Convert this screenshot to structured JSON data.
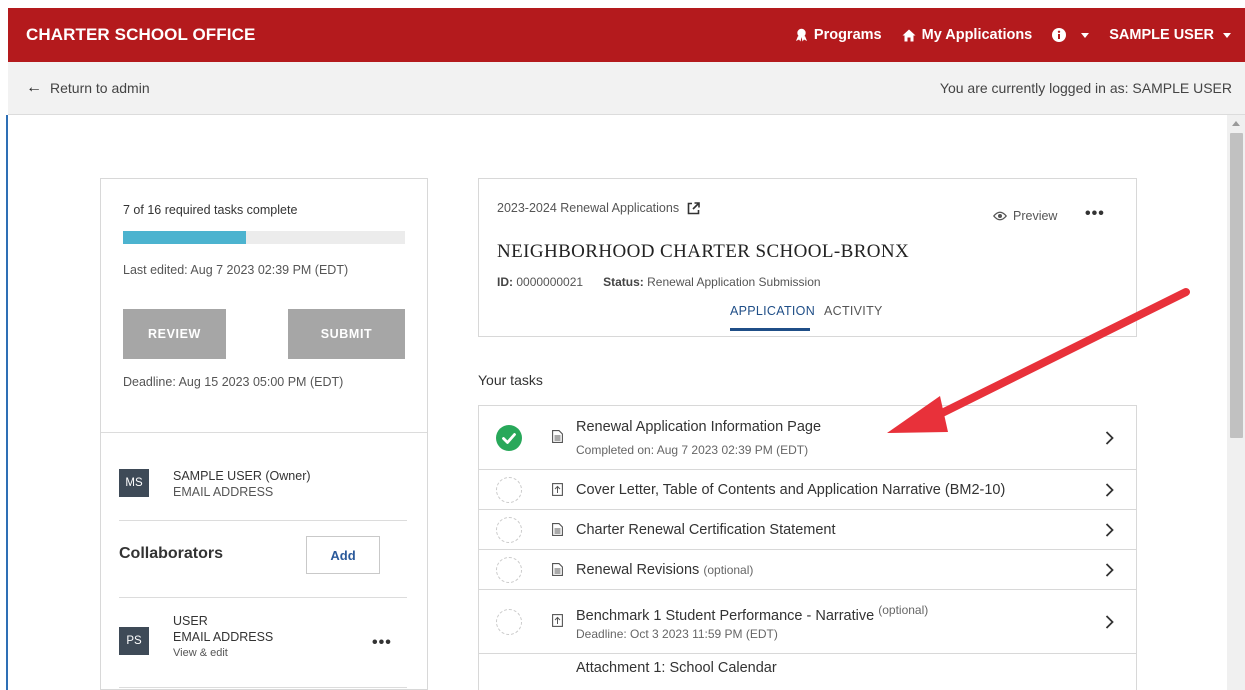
{
  "header": {
    "brand": "CHARTER SCHOOL OFFICE",
    "nav": {
      "programs": "Programs",
      "my_applications": "My Applications",
      "user": "SAMPLE USER"
    },
    "bg_color": "#b41a1d"
  },
  "subbar": {
    "return_label": "Return to admin",
    "logged_in": "You are currently logged in as: SAMPLE USER"
  },
  "summary": {
    "progress_text": "7 of 16 required tasks complete",
    "progress_fraction": 0.4375,
    "last_edited": "Last edited: Aug 7 2023 02:39 PM (EDT)",
    "review_label": "REVIEW",
    "submit_label": "SUBMIT",
    "deadline": "Deadline: Aug 15 2023 05:00 PM (EDT)"
  },
  "owner": {
    "initials": "MS",
    "name": "SAMPLE USER (Owner)",
    "email": "EMAIL ADDRESS"
  },
  "collaborators": {
    "title": "Collaborators",
    "add_label": "Add",
    "items": [
      {
        "initials": "PS",
        "name": "USER",
        "email": "EMAIL ADDRESS",
        "permission": "View & edit"
      }
    ]
  },
  "application": {
    "program": "2023-2024 Renewal Applications",
    "preview_label": "Preview",
    "school_name": "NEIGHBORHOOD CHARTER SCHOOL-BRONX",
    "id_label": "ID:",
    "id_value": "0000000021",
    "status_label": "Status:",
    "status_value": "Renewal Application Submission",
    "tabs": [
      "APPLICATION",
      "ACTIVITY"
    ]
  },
  "tasks": {
    "title": "Your tasks",
    "items": [
      {
        "label": "Renewal Application Information Page",
        "optional": "",
        "sub": "Completed on: Aug 7 2023 02:39 PM (EDT)",
        "status": "complete",
        "icon": "document-icon"
      },
      {
        "label": "Cover Letter, Table of Contents and Application Narrative (BM2-10)",
        "optional": "",
        "sub": "",
        "status": "pending",
        "icon": "upload-icon"
      },
      {
        "label": "Charter Renewal Certification Statement",
        "optional": "",
        "sub": "",
        "status": "pending",
        "icon": "document-icon"
      },
      {
        "label": "Renewal Revisions",
        "optional": "(optional)",
        "sub": "",
        "status": "pending",
        "icon": "document-icon"
      },
      {
        "label": "Benchmark 1 Student Performance - Narrative",
        "optional": "(optional)",
        "sub": "Deadline: Oct 3 2023 11:59 PM (EDT)",
        "status": "pending",
        "icon": "upload-icon"
      },
      {
        "label": "Attachment 1: School Calendar",
        "optional": "",
        "sub": "",
        "status": "pending",
        "icon": "upload-icon"
      }
    ]
  },
  "annotation": {
    "arrow_color": "#e8313a"
  }
}
